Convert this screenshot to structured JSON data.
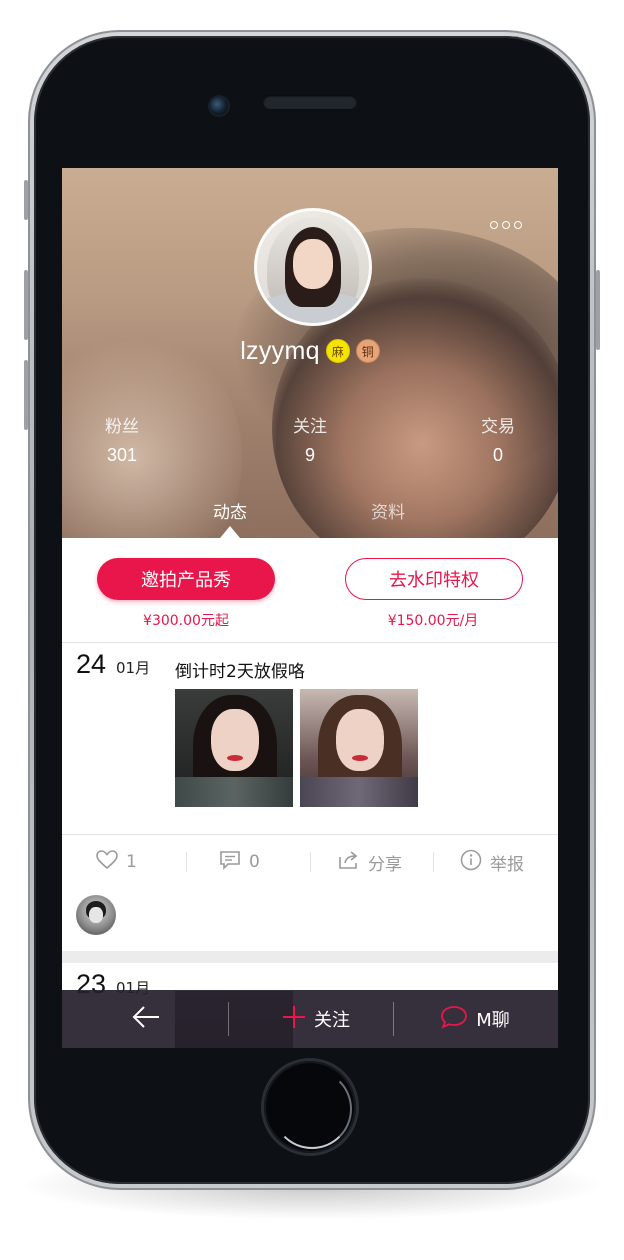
{
  "profile": {
    "username": "lzyymq",
    "badges": [
      {
        "text": "麻",
        "color": "#f5e400"
      },
      {
        "text": "铜",
        "color": "#e7a477"
      }
    ],
    "more_icon": "more-dots-icon"
  },
  "stats": [
    {
      "label": "粉丝",
      "value": "301"
    },
    {
      "label": "关注",
      "value": "9"
    },
    {
      "label": "交易",
      "value": "0"
    }
  ],
  "tabs": [
    {
      "label": "动态",
      "active": true
    },
    {
      "label": "资料",
      "active": false
    }
  ],
  "actions": {
    "invite_label": "邀拍产品秀",
    "invite_price": "¥300.00元起",
    "watermark_label": "去水印特权",
    "watermark_price": "¥150.00元/月",
    "accent_color": "#e8164b"
  },
  "posts": [
    {
      "day": "24",
      "month": "01月",
      "text": "倒计时2天放假咯",
      "photo_count": 2,
      "likes": "1",
      "comments": "0",
      "share_label": "分享",
      "report_label": "举报"
    },
    {
      "day": "23",
      "month": "01月"
    }
  ],
  "bottom_bar": {
    "back_icon": "back-arrow-icon",
    "follow_label": "关注",
    "chat_label": "M聊"
  }
}
